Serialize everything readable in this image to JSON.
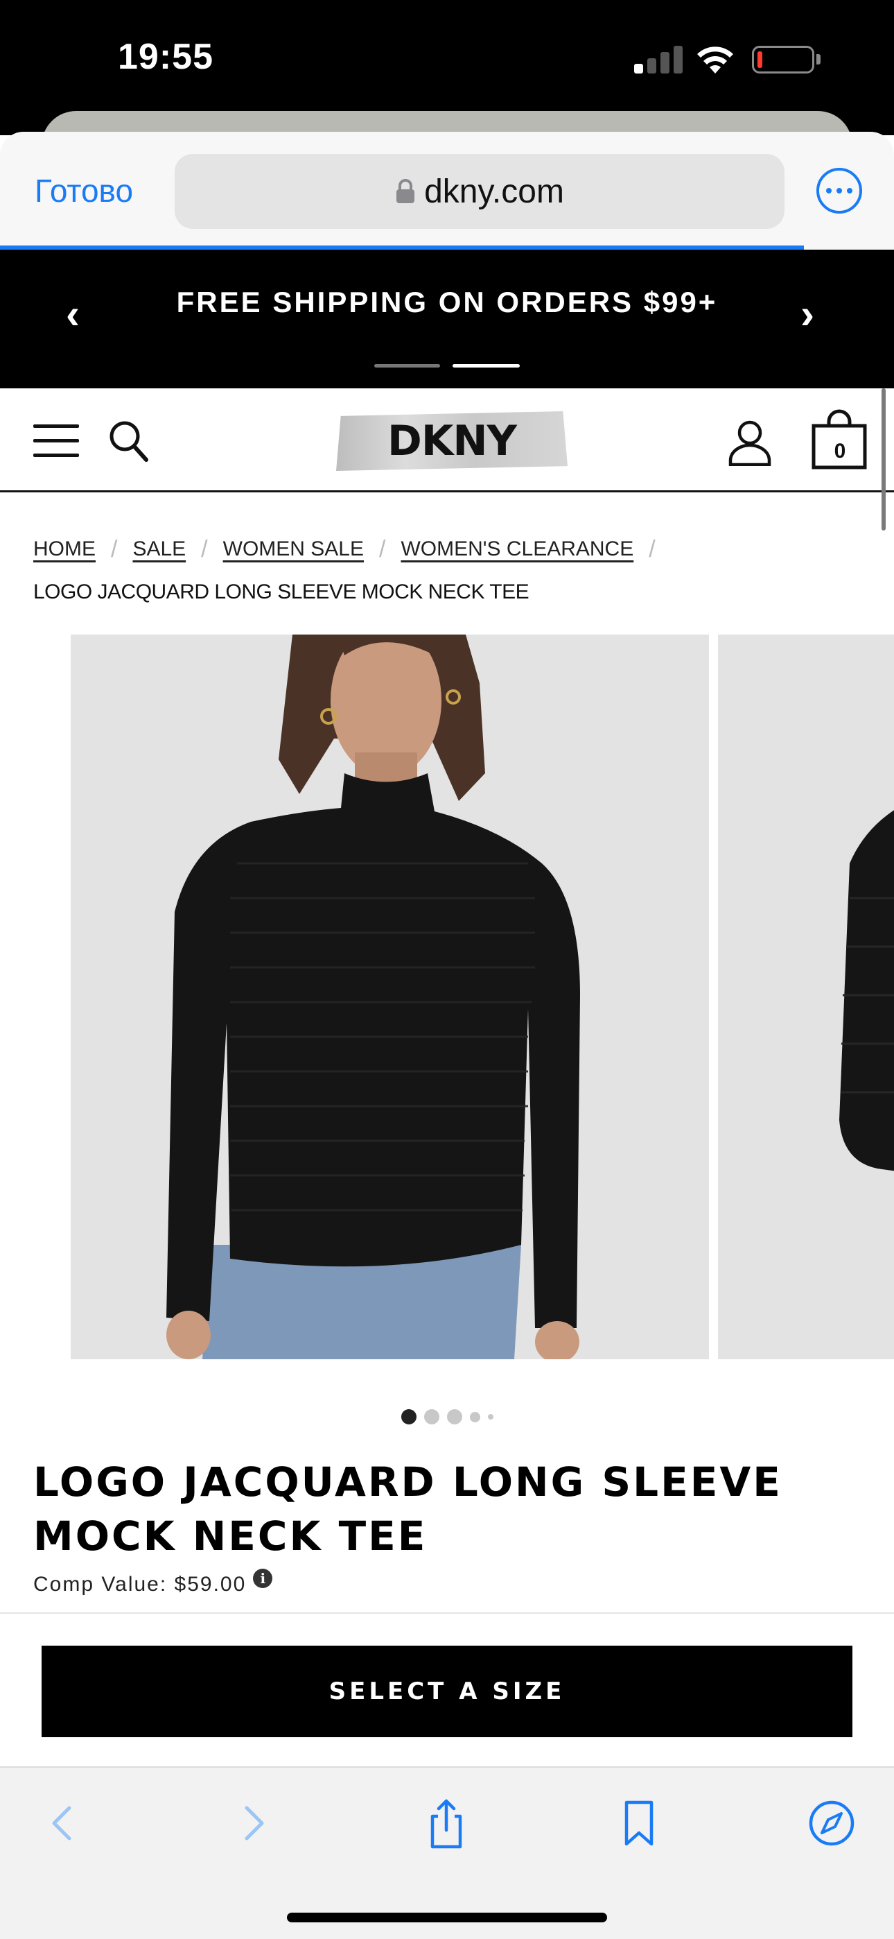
{
  "status_bar": {
    "time": "19:55",
    "icons": [
      "cellular-signal-icon",
      "wifi-icon",
      "battery-low-icon"
    ]
  },
  "browser": {
    "done_label": "Готово",
    "url": "dkny.com",
    "lock_icon": "lock-icon",
    "more_icon": "more-icon",
    "accent_color": "#1a7cf5"
  },
  "promo": {
    "text": "FREE SHIPPING ON ORDERS $99+",
    "prev": "‹",
    "next": "›",
    "slides_total": 2,
    "active_slide": 2
  },
  "header": {
    "logo": "DKNY",
    "bag_count": "0",
    "icons": [
      "menu-icon",
      "search-icon",
      "account-icon",
      "shopping-bag-icon"
    ]
  },
  "breadcrumb": {
    "items": [
      "HOME",
      "SALE",
      "WOMEN SALE",
      "WOMEN'S CLEARANCE"
    ],
    "current": "LOGO JACQUARD LONG SLEEVE MOCK NECK TEE"
  },
  "gallery": {
    "dots_total": 5,
    "active_dot": 1
  },
  "product": {
    "title": "LOGO JACQUARD LONG SLEEVE MOCK NECK TEE",
    "comp_value": "Comp Value: $59.00",
    "info_icon": "i"
  },
  "cta": {
    "label": "SELECT A SIZE"
  },
  "toolbar": {
    "icons": [
      "back-icon",
      "forward-icon",
      "share-icon",
      "bookmarks-icon",
      "compass-icon"
    ]
  }
}
